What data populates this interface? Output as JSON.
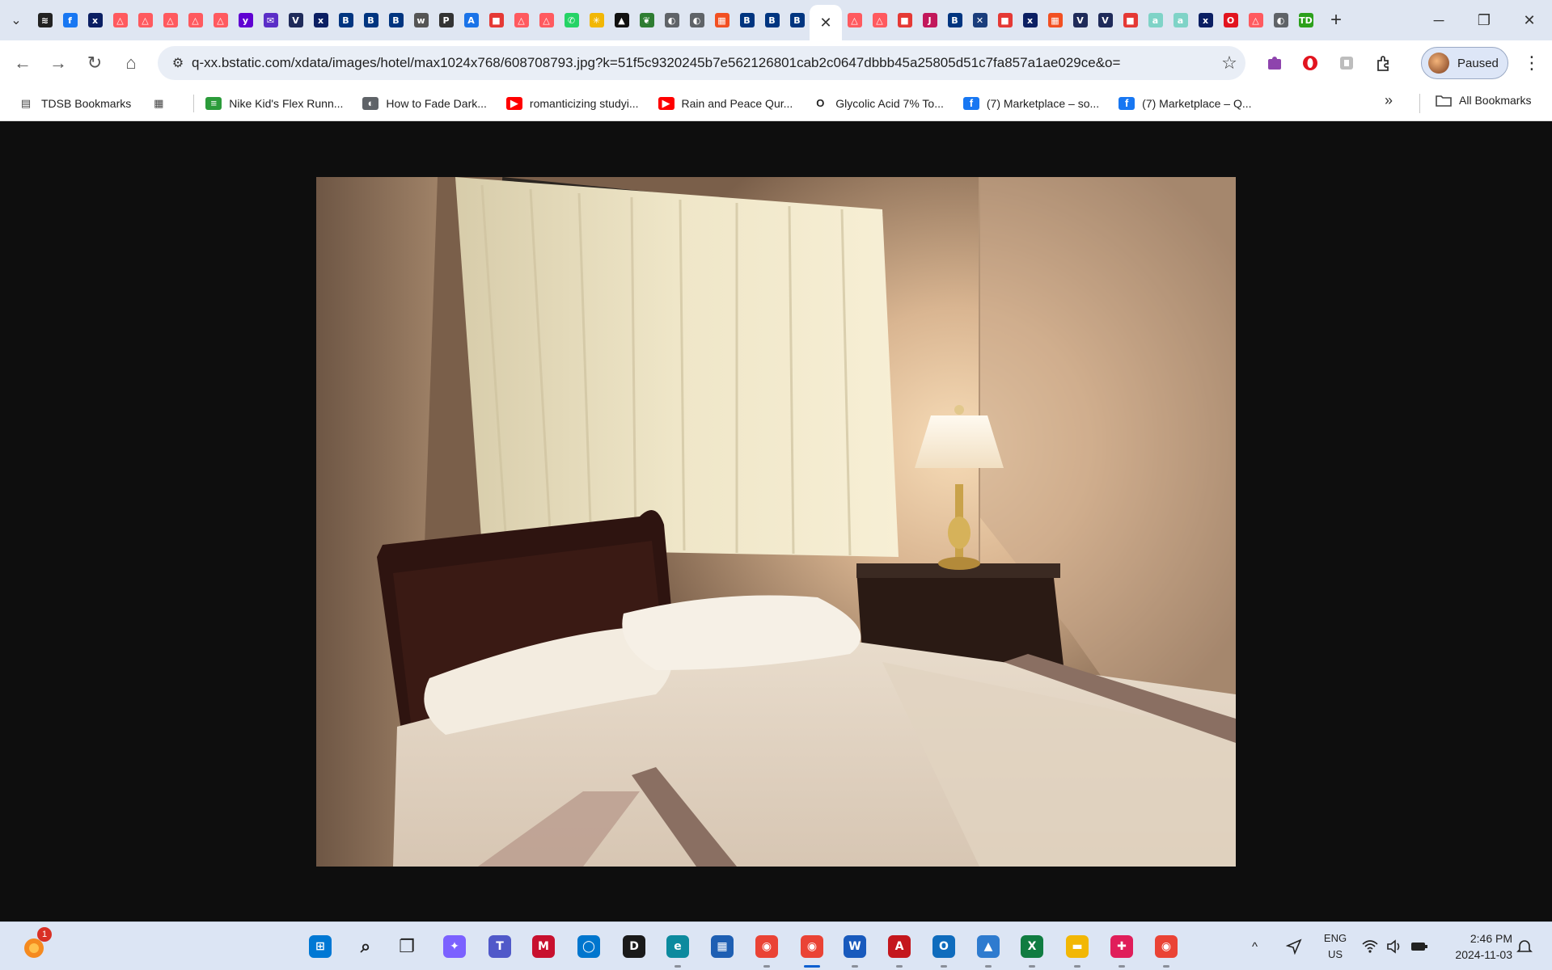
{
  "browser": {
    "tabs": [
      {
        "icon": "bookmark-icon",
        "color": "#222222",
        "glyph": "≋"
      },
      {
        "icon": "facebook-icon",
        "color": "#1877f2",
        "glyph": "f"
      },
      {
        "icon": "xe-icon",
        "color": "#0b1f63",
        "glyph": "x"
      },
      {
        "icon": "airbnb-icon",
        "color": "#ff5a5f",
        "glyph": "△"
      },
      {
        "icon": "airbnb-icon",
        "color": "#ff5a5f",
        "glyph": "△"
      },
      {
        "icon": "airbnb-icon",
        "color": "#ff5a5f",
        "glyph": "△"
      },
      {
        "icon": "airbnb-icon",
        "color": "#ff5a5f",
        "glyph": "△"
      },
      {
        "icon": "airbnb-icon",
        "color": "#ff5a5f",
        "glyph": "△"
      },
      {
        "icon": "yahoo-icon",
        "color": "#6001d2",
        "glyph": "y"
      },
      {
        "icon": "mail-icon",
        "color": "#5b2ec7",
        "glyph": "✉"
      },
      {
        "icon": "vrbo-icon",
        "color": "#1f2b5a",
        "glyph": "V"
      },
      {
        "icon": "xe-icon",
        "color": "#0b1f63",
        "glyph": "x"
      },
      {
        "icon": "booking-icon",
        "color": "#003580",
        "glyph": "B"
      },
      {
        "icon": "booking-icon",
        "color": "#003580",
        "glyph": "B"
      },
      {
        "icon": "booking-icon",
        "color": "#003580",
        "glyph": "B"
      },
      {
        "icon": "wf-icon",
        "color": "#555555",
        "glyph": "w"
      },
      {
        "icon": "p-icon",
        "color": "#333333",
        "glyph": "P"
      },
      {
        "icon": "draw-icon",
        "color": "#1a73e8",
        "glyph": "A"
      },
      {
        "icon": "red-square-icon",
        "color": "#e53935",
        "glyph": "■"
      },
      {
        "icon": "airbnb-icon",
        "color": "#ff5a5f",
        "glyph": "△"
      },
      {
        "icon": "airbnb-icon",
        "color": "#ff5a5f",
        "glyph": "△"
      },
      {
        "icon": "whatsapp-icon",
        "color": "#25d366",
        "glyph": "✆"
      },
      {
        "icon": "sparkle-icon",
        "color": "#f2b705",
        "glyph": "✳"
      },
      {
        "icon": "image-icon",
        "color": "#111111",
        "glyph": "▲"
      },
      {
        "icon": "leaf-icon",
        "color": "#2e7d32",
        "glyph": "❦"
      },
      {
        "icon": "globe-icon",
        "color": "#5f6368",
        "glyph": "◐"
      },
      {
        "icon": "globe-icon",
        "color": "#5f6368",
        "glyph": "◐"
      },
      {
        "icon": "microsoft-icon",
        "color": "#f25022",
        "glyph": "▦"
      },
      {
        "icon": "booking-icon",
        "color": "#003580",
        "glyph": "B"
      },
      {
        "icon": "booking-icon",
        "color": "#003580",
        "glyph": "B"
      },
      {
        "icon": "booking-icon",
        "color": "#003580",
        "glyph": "B"
      },
      {
        "icon": "close-icon",
        "color": "#ffffff",
        "glyph": "✕",
        "active": true
      },
      {
        "icon": "airbnb-icon",
        "color": "#ff5a5f",
        "glyph": "△"
      },
      {
        "icon": "airbnb-icon",
        "color": "#ff5a5f",
        "glyph": "△"
      },
      {
        "icon": "red-square-icon",
        "color": "#e53935",
        "glyph": "■"
      },
      {
        "icon": "jpg-icon",
        "color": "#c2185b",
        "glyph": "J"
      },
      {
        "icon": "booking-icon",
        "color": "#003580",
        "glyph": "B"
      },
      {
        "icon": "pattern-icon",
        "color": "#1a3d7c",
        "glyph": "✕"
      },
      {
        "icon": "red-square-icon",
        "color": "#e53935",
        "glyph": "■"
      },
      {
        "icon": "xe-icon",
        "color": "#0b1f63",
        "glyph": "x"
      },
      {
        "icon": "microsoft-icon",
        "color": "#f25022",
        "glyph": "▦"
      },
      {
        "icon": "vrbo-icon",
        "color": "#1f2b5a",
        "glyph": "V"
      },
      {
        "icon": "v-icon",
        "color": "#1f2b5a",
        "glyph": "V"
      },
      {
        "icon": "red-square-icon",
        "color": "#e53935",
        "glyph": "■"
      },
      {
        "icon": "amazon-icon",
        "color": "#7fd3c7",
        "glyph": "a"
      },
      {
        "icon": "amazon-icon",
        "color": "#7fd3c7",
        "glyph": "a"
      },
      {
        "icon": "xe-icon",
        "color": "#0b1f63",
        "glyph": "x"
      },
      {
        "icon": "opera-icon",
        "color": "#e2141f",
        "glyph": "O"
      },
      {
        "icon": "airbnb-icon",
        "color": "#ff5a5f",
        "glyph": "△"
      },
      {
        "icon": "globe-icon",
        "color": "#5f6368",
        "glyph": "◐"
      },
      {
        "icon": "td-icon",
        "color": "#2ca01c",
        "glyph": "TD"
      }
    ],
    "new_tab_glyph": "+",
    "tab_search_glyph": "⌄",
    "window_controls": {
      "minimize": "─",
      "restore": "❐",
      "close": "✕"
    }
  },
  "toolbar": {
    "back": "←",
    "forward": "→",
    "reload": "↻",
    "home": "⌂",
    "site_info": "⚙",
    "url": "q-xx.bstatic.com/xdata/images/hotel/max1024x768/608708793.jpg?k=51f5c9320245b7e562126801cab2c0647dbbb45a25805d51c7fa857a1ae029ce&o=",
    "bookmark_star": "☆",
    "profile_label": "Paused",
    "menu": "⋮"
  },
  "bookmarks": {
    "items": [
      {
        "label": "TDSB Bookmarks",
        "icon": "folder-icon"
      },
      {
        "label": "",
        "icon": "apps-grid-icon"
      },
      {
        "label": "Nike Kid's Flex Runn...",
        "icon": "nike-stripes-icon"
      },
      {
        "label": "How to Fade Dark...",
        "icon": "globe-icon"
      },
      {
        "label": "romanticizing studyi...",
        "icon": "youtube-icon"
      },
      {
        "label": "Rain and Peace Qur...",
        "icon": "youtube-icon"
      },
      {
        "label": "Glycolic Acid 7% To...",
        "icon": "ordinary-icon"
      },
      {
        "label": "(7) Marketplace – so...",
        "icon": "facebook-icon"
      },
      {
        "label": "(7) Marketplace – Q...",
        "icon": "facebook-icon"
      }
    ],
    "more": "»",
    "all_bookmarks": "All Bookmarks"
  },
  "taskbar": {
    "apps": [
      {
        "name": "start-icon",
        "color": "#0078d4",
        "glyph": "⊞"
      },
      {
        "name": "search-icon",
        "color": "#222222",
        "glyph": "⌕"
      },
      {
        "name": "task-view-icon",
        "color": "#222222",
        "glyph": "❐"
      },
      {
        "name": "copilot-icon",
        "color": "#7b61ff",
        "glyph": "✦"
      },
      {
        "name": "teams-icon",
        "color": "#5059c9",
        "glyph": "T"
      },
      {
        "name": "mcafee-icon",
        "color": "#c8102e",
        "glyph": "M"
      },
      {
        "name": "dell-app-icon",
        "color": "#0076ce",
        "glyph": "◯"
      },
      {
        "name": "dell-icon",
        "color": "#1a1a1a",
        "glyph": "D"
      },
      {
        "name": "edge-icon",
        "color": "#0c8a9e",
        "glyph": "e"
      },
      {
        "name": "store-icon",
        "color": "#1e5fb3",
        "glyph": "▦"
      },
      {
        "name": "chrome-icon",
        "color": "#ea4335",
        "glyph": "◉"
      },
      {
        "name": "chrome-profile-icon",
        "color": "#ea4335",
        "glyph": "◉"
      },
      {
        "name": "word-icon",
        "color": "#185abd",
        "glyph": "W"
      },
      {
        "name": "acrobat-icon",
        "color": "#c4171d",
        "glyph": "A"
      },
      {
        "name": "outlook-icon",
        "color": "#0f6cbd",
        "glyph": "O"
      },
      {
        "name": "photos-icon",
        "color": "#2e7bcf",
        "glyph": "▲"
      },
      {
        "name": "excel-icon",
        "color": "#107c41",
        "glyph": "X"
      },
      {
        "name": "file-explorer-icon",
        "color": "#f2b705",
        "glyph": "▬"
      },
      {
        "name": "slack-icon",
        "color": "#e01e5a",
        "glyph": "✚"
      },
      {
        "name": "chrome-alt-icon",
        "color": "#ea4335",
        "glyph": "◉"
      }
    ],
    "notification_count": "1",
    "tray_chevron": "^",
    "lang_line1": "ENG",
    "lang_line2": "US",
    "time": "2:46 PM",
    "date": "2024-11-03"
  }
}
